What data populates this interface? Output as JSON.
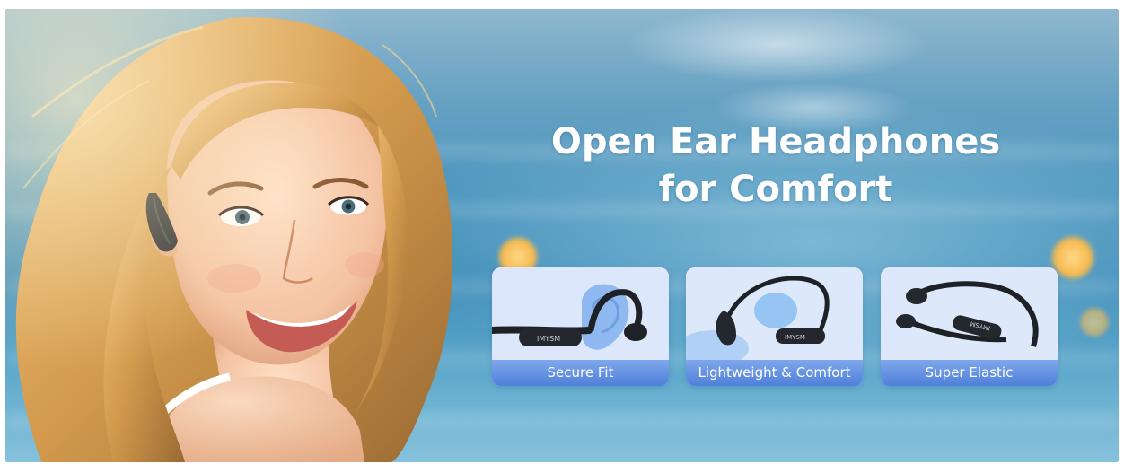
{
  "headline": {
    "line1": "Open Ear Headphones",
    "line2": "for Comfort"
  },
  "features": [
    {
      "label": "Secure Fit",
      "icon": "headphone-on-ear-image",
      "brand_text": "IMYSM"
    },
    {
      "label": "Lightweight & Comfort",
      "icon": "headphone-with-feather-image",
      "brand_text": "IMYSM"
    },
    {
      "label": "Super Elastic",
      "icon": "headphone-bent-image",
      "brand_text": "IMYSM"
    }
  ],
  "colors": {
    "caption_bar": "#5a88dc",
    "card_background": "#d9e5f9",
    "ocean": "#4b95bd",
    "text": "#ffffff"
  }
}
